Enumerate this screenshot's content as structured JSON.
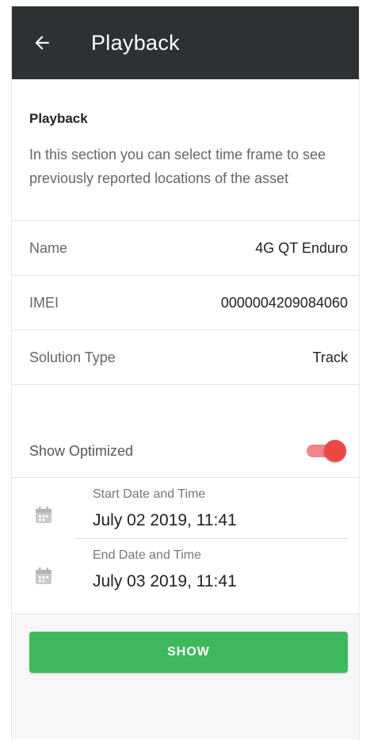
{
  "appbar": {
    "title": "Playback"
  },
  "intro": {
    "heading": "Playback",
    "description": "In this section you can select time frame to see previously reported locations of the asset"
  },
  "details": [
    {
      "label": "Name",
      "value": "4G QT Enduro"
    },
    {
      "label": "IMEI",
      "value": "0000004209084060"
    },
    {
      "label": "Solution Type",
      "value": "Track"
    }
  ],
  "optimized": {
    "label": "Show Optimized",
    "enabled": true
  },
  "start": {
    "label": "Start Date and Time",
    "value": "July 02 2019, 11:41"
  },
  "end": {
    "label": "End Date and Time",
    "value": "July 03 2019, 11:41"
  },
  "actions": {
    "show_label": "SHOW"
  },
  "colors": {
    "appbar": "#2d3133",
    "accent": "#ee4845",
    "button": "#3db85c"
  }
}
